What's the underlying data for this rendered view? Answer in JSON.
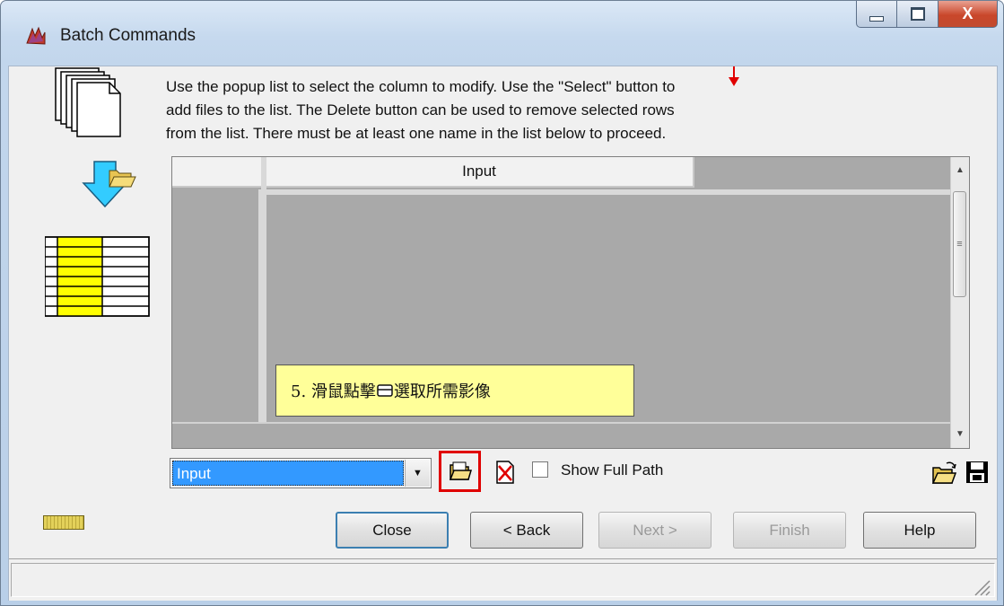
{
  "window": {
    "title": "Batch Commands",
    "caption_buttons": {
      "minimize": "minimize",
      "maximize": "maximize",
      "close": "X"
    }
  },
  "instructions": "Use the popup list to select the column to modify. Use the \"Select\" button to\nadd files to the list. The Delete button can be used to remove selected rows\nfrom the list. There must be at least one name in the list below to proceed.",
  "grid": {
    "columns": [
      "",
      "Input"
    ]
  },
  "annotation": {
    "text_before": "5. 滑鼠點擊",
    "text_after": "選取所需影像",
    "color": "#ffff99"
  },
  "toolbar": {
    "column_select_value": "Input",
    "show_full_path_label": "Show Full Path",
    "show_full_path_checked": false
  },
  "buttons": {
    "close": "Close",
    "back": "< Back",
    "next": "Next >",
    "finish": "Finish",
    "help": "Help"
  },
  "icons": {
    "select_files": "open-folder-icon",
    "delete_rows": "delete-file-icon",
    "open_list": "open-folder-icon",
    "save_list": "floppy-disk-icon"
  },
  "colors": {
    "highlight_box": "#e00000",
    "selection": "#3399ff",
    "grid_background": "#a9a9a9"
  }
}
